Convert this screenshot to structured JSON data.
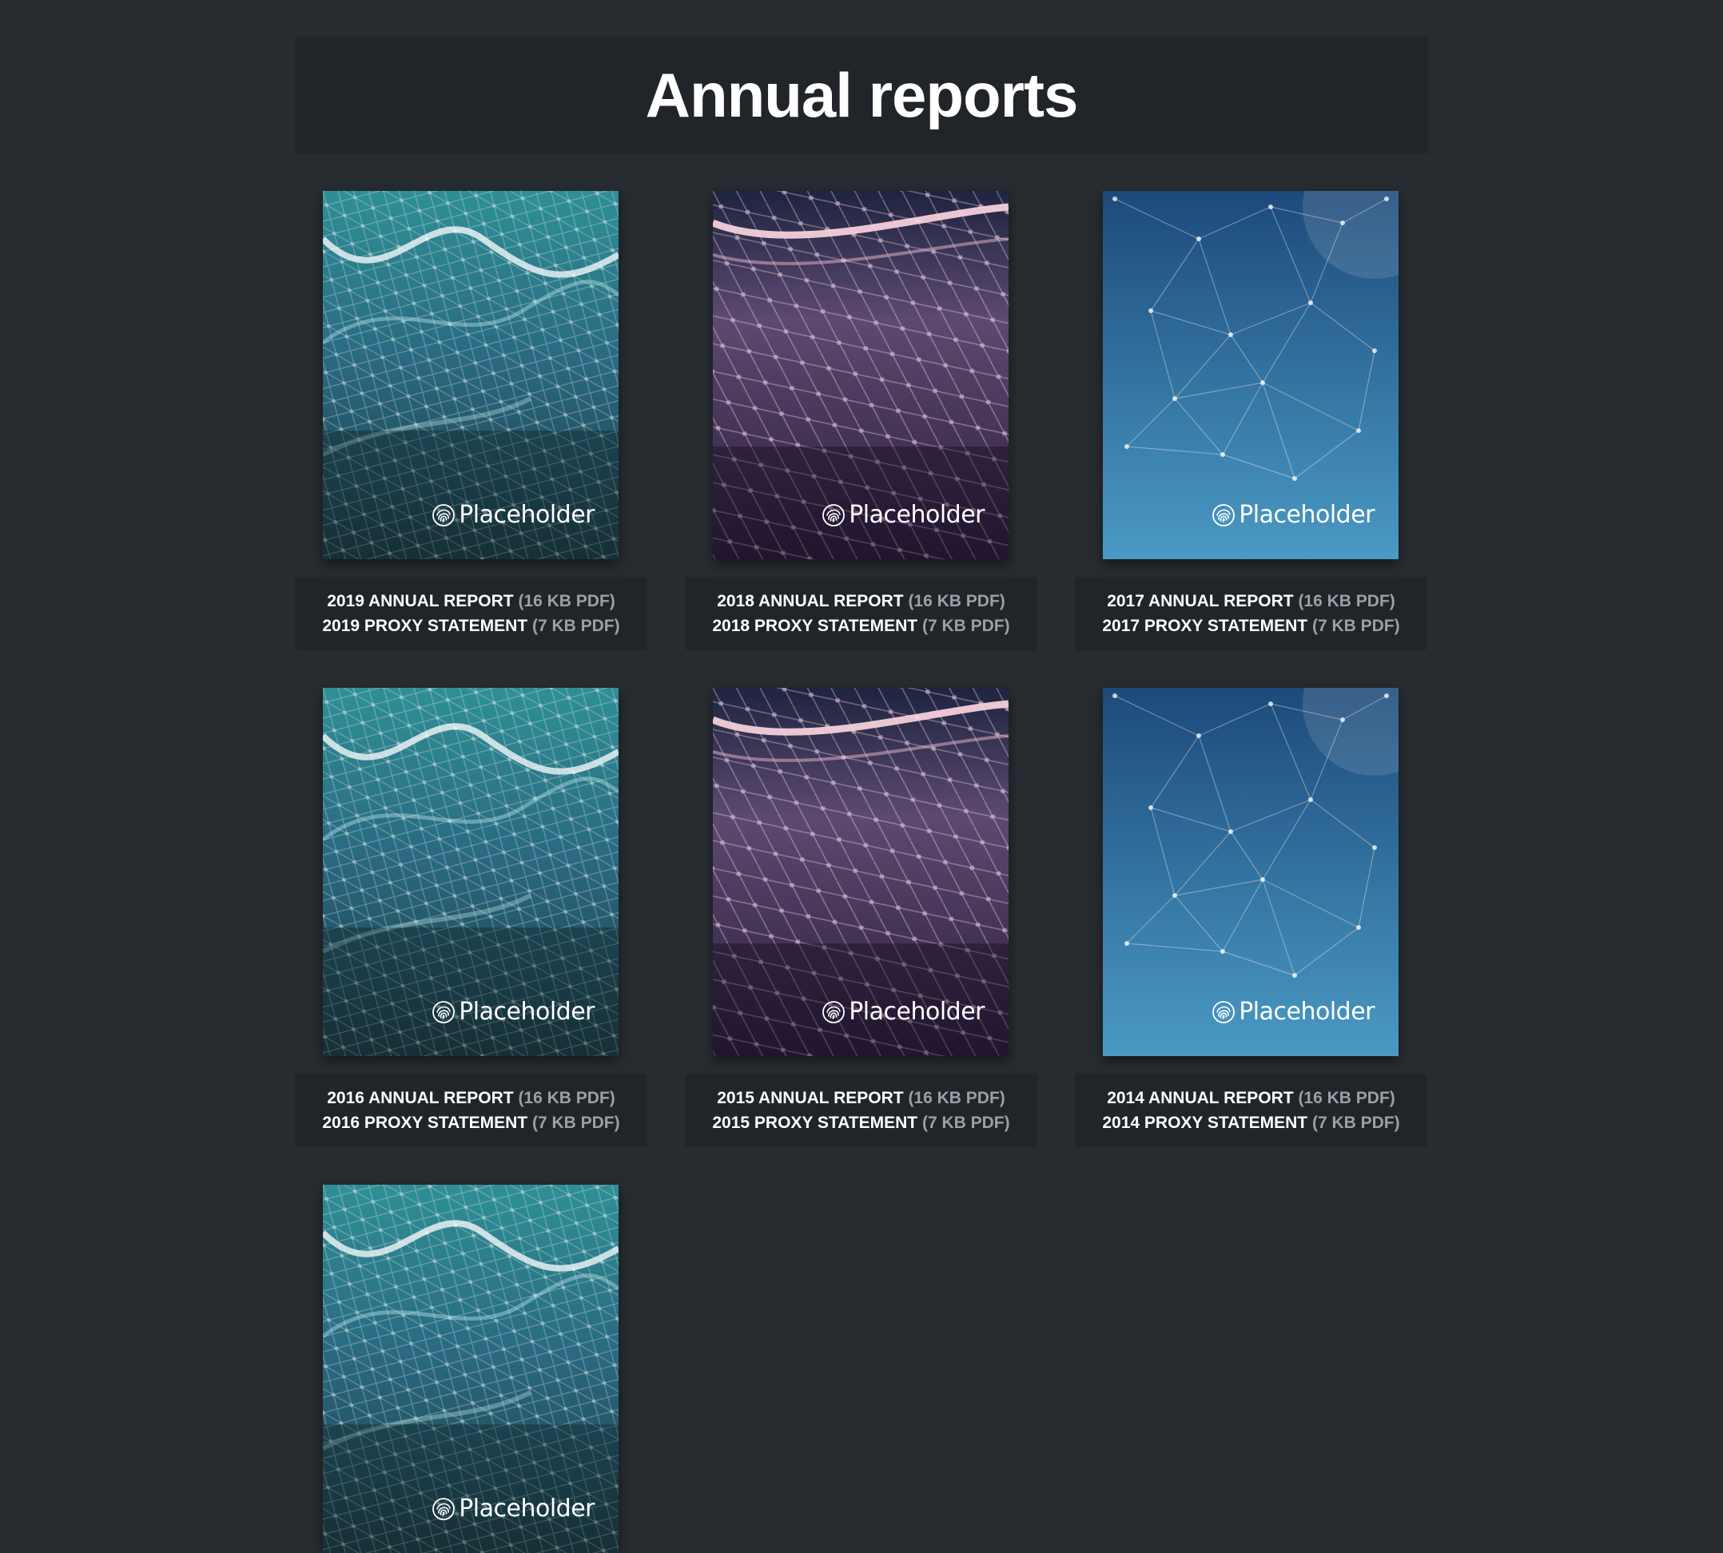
{
  "page": {
    "title": "Annual reports"
  },
  "brand_text": "Placeholder",
  "reports": [
    {
      "theme": "teal",
      "report_label": "2019 ANNUAL REPORT",
      "report_size": "(16 KB PDF)",
      "proxy_label": "2019 PROXY STATEMENT",
      "proxy_size": "(7 KB PDF)"
    },
    {
      "theme": "purple",
      "report_label": "2018 ANNUAL REPORT",
      "report_size": "(16 KB PDF)",
      "proxy_label": "2018 PROXY STATEMENT",
      "proxy_size": "(7 KB PDF)"
    },
    {
      "theme": "blue",
      "report_label": "2017 ANNUAL REPORT",
      "report_size": "(16 KB PDF)",
      "proxy_label": "2017 PROXY STATEMENT",
      "proxy_size": "(7 KB PDF)"
    },
    {
      "theme": "teal",
      "report_label": "2016 ANNUAL REPORT",
      "report_size": "(16 KB PDF)",
      "proxy_label": "2016 PROXY STATEMENT",
      "proxy_size": "(7 KB PDF)"
    },
    {
      "theme": "purple",
      "report_label": "2015 ANNUAL REPORT",
      "report_size": "(16 KB PDF)",
      "proxy_label": "2015 PROXY STATEMENT",
      "proxy_size": "(7 KB PDF)"
    },
    {
      "theme": "blue",
      "report_label": "2014 ANNUAL REPORT",
      "report_size": "(16 KB PDF)",
      "proxy_label": "2014 PROXY STATEMENT",
      "proxy_size": "(7 KB PDF)"
    },
    {
      "theme": "teal"
    }
  ],
  "colors": {
    "page_background": "#272c31",
    "panel_background": "#212529",
    "title_text": "#ffffff",
    "size_text": "#9aa0a6"
  }
}
